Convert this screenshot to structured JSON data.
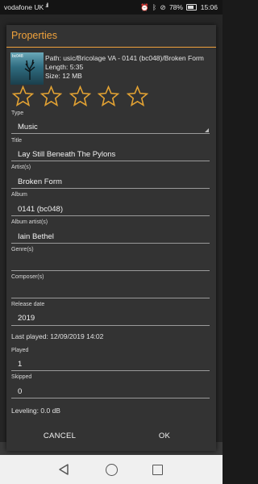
{
  "status_bar": {
    "carrier": "vodafone UK",
    "signal": ".ıll",
    "wifi": "◈",
    "alarm": "⏰",
    "bluetooth": "ᛒ",
    "vibrate": "⊘",
    "battery": "78%",
    "time": "15:06"
  },
  "dialog": {
    "title": "Properties",
    "path": "Path: usic/Bricolage VA - 0141 (bc048)/Broken Form",
    "length": "Length: 5:35",
    "size": "Size: 12 MB",
    "cover_tag": "bc048",
    "rating": {
      "value": 0,
      "max": 5
    },
    "fields": {
      "type": {
        "label": "Type",
        "value": "Music"
      },
      "title": {
        "label": "Title",
        "value": "Lay Still Beneath The Pylons"
      },
      "artist": {
        "label": "Artist(s)",
        "value": "Broken Form"
      },
      "album": {
        "label": "Album",
        "value": "0141 (bc048)"
      },
      "album_artist": {
        "label": "Album artist(s)",
        "value": "Iain Bethel"
      },
      "genre": {
        "label": "Genre(s)",
        "value": ""
      },
      "composer": {
        "label": "Composer(s)",
        "value": ""
      },
      "release_date": {
        "label": "Release date",
        "value": "2019"
      },
      "played": {
        "label": "Played",
        "value": "1"
      },
      "skipped": {
        "label": "Skipped",
        "value": "0"
      }
    },
    "last_played": "Last played: 12/09/2019 14:02",
    "leveling": "Leveling: 0.0 dB",
    "cancel_label": "CANCEL",
    "ok_label": "OK"
  },
  "colors": {
    "accent": "#f0a23c",
    "dialog_bg": "#333333",
    "star_outline": "#e3a233"
  },
  "icons": [
    "back-icon",
    "home-icon",
    "recent-apps-icon",
    "star-outline-icon",
    "dropdown-icon"
  ]
}
